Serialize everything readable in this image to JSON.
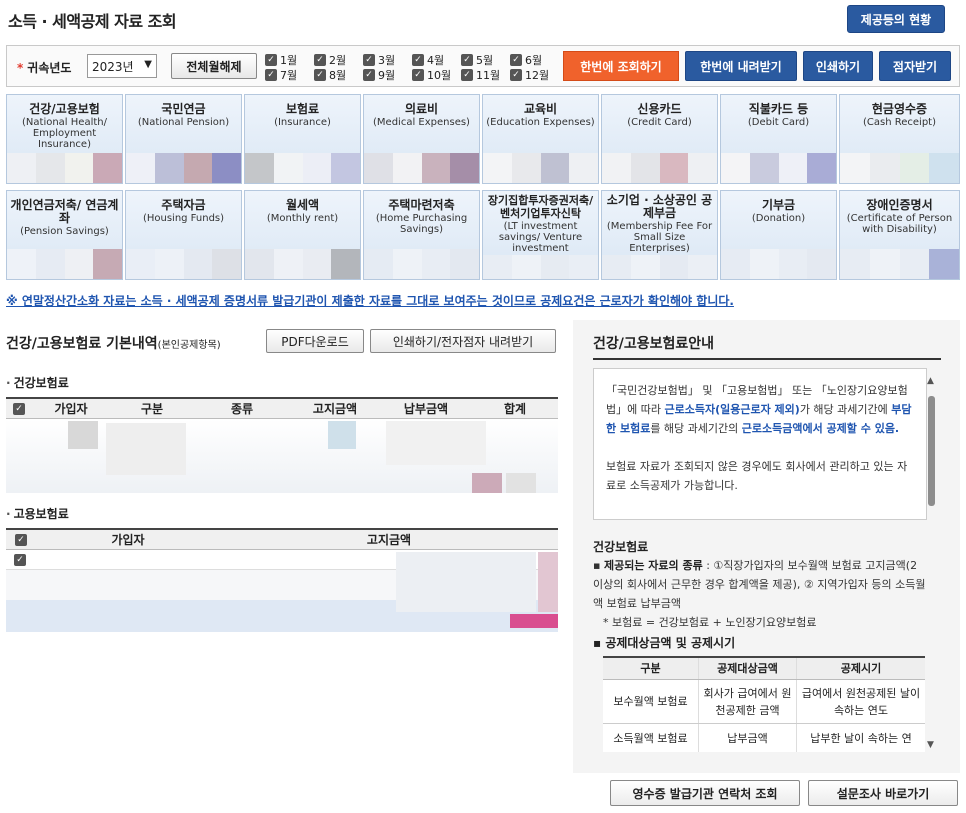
{
  "page": {
    "title": "소득 · 세액공제 자료 조회",
    "provide_status": "제공등의 현황"
  },
  "filter": {
    "year_label": "귀속년도",
    "year_value": "2023년",
    "release_all": "전체월해제",
    "months": [
      "1월",
      "2월",
      "3월",
      "4월",
      "5월",
      "6월",
      "7월",
      "8월",
      "9월",
      "10월",
      "11월",
      "12월"
    ],
    "query_all": "한번에 조회하기",
    "download_all": "한번에 내려받기",
    "print": "인쇄하기",
    "braille": "점자받기"
  },
  "tiles_row1": [
    {
      "ko": "건강/고용보험",
      "en": "(National Health/ Employment Insurance)"
    },
    {
      "ko": "국민연금",
      "en": "(National Pension)"
    },
    {
      "ko": "보험료",
      "en": "(Insurance)"
    },
    {
      "ko": "의료비",
      "en": "(Medical Expenses)"
    },
    {
      "ko": "교육비",
      "en": "(Education Expenses)"
    },
    {
      "ko": "신용카드",
      "en": "(Credit Card)"
    },
    {
      "ko": "직불카드 등",
      "en": "(Debit Card)"
    },
    {
      "ko": "현금영수증",
      "en": "(Cash Receipt)"
    }
  ],
  "tiles_row2": [
    {
      "ko": "개인연금저축/ 연금계좌",
      "en": "(Pension Savings)"
    },
    {
      "ko": "주택자금",
      "en": "(Housing Funds)"
    },
    {
      "ko": "월세액",
      "en": "(Monthly rent)"
    },
    {
      "ko": "주택마련저축",
      "en": "(Home Purchasing Savings)"
    },
    {
      "ko": "장기집합투자증권저축/ 벤처기업투자신탁",
      "en": "(LT investment savings/ Venture investment"
    },
    {
      "ko": "소기업 · 소상공인 공제부금",
      "en": "(Membership Fee For Small Size Enterprises)"
    },
    {
      "ko": "기부금",
      "en": "(Donation)"
    },
    {
      "ko": "장애인증명서",
      "en": "(Certificate of Person with Disability)"
    }
  ],
  "notice": "※ 연말정산간소화 자료는 소득 · 세액공제 증명서류 발급기관이 제출한 자료를 그대로 보여주는 것이므로 공제요건은 근로자가 확인해야 합니다.",
  "left": {
    "title": "건강/고용보험료 기본내역",
    "title_note": "(본인공제항목)",
    "pdf_download": "PDF다운로드",
    "print_braille": "인쇄하기/전자점자 내려받기",
    "health_title": "건강보험료",
    "health_headers": [
      "가입자",
      "구분",
      "종류",
      "고지금액",
      "납부금액",
      "합계"
    ],
    "employ_title": "고용보험료",
    "employ_headers": [
      "가입자",
      "고지금액"
    ]
  },
  "right": {
    "title": "건강/고용보험료안내",
    "box_p1_a": "「국민건강보험법」 및 「고용보험법」 또는 「노인장기요양보험법」에 따라 ",
    "box_p1_hl1": "근로소득자(일용근로자 제외)",
    "box_p1_b": "가 해당 과세기간에 ",
    "box_p1_hl2": "부담한 보험료",
    "box_p1_c": "를 해당 과세기간의 ",
    "box_p1_hl3": "근로소득금액에서 공제할 수 있음.",
    "box_p2": "보험료 자료가 조회되지 않은 경우에도 회사에서 관리하고 있는 자료로 소득공제가 가능합니다.",
    "health_sub": "건강보험료",
    "provided_label": "제공되는 자료의 종류",
    "provided_text": " : ①직장가입자의 보수월액 보험료 고지금액(2 이상의 회사에서 근무한 경우 합계액을 제공), ② 지역가입자 등의 소득월액 보험료 납부금액",
    "formula": "* 보험료 = 건강보험료 + 노인장기요양보험료",
    "deduct_sub": "공제대상금액 및 공제시기",
    "table_headers": [
      "구분",
      "공제대상금액",
      "공제시기"
    ],
    "table_rows": [
      [
        "보수월액 보험료",
        "회사가 급여에서 원천공제한 금액",
        "급여에서 원천공제된 날이 속하는 연도"
      ],
      [
        "소득월액 보험료",
        "납부금액",
        "납부한 날이 속하는 연"
      ]
    ]
  },
  "bottom": {
    "receipt_contact": "영수증 발급기관 연락처 조회",
    "survey": "설문조사 바로가기"
  }
}
